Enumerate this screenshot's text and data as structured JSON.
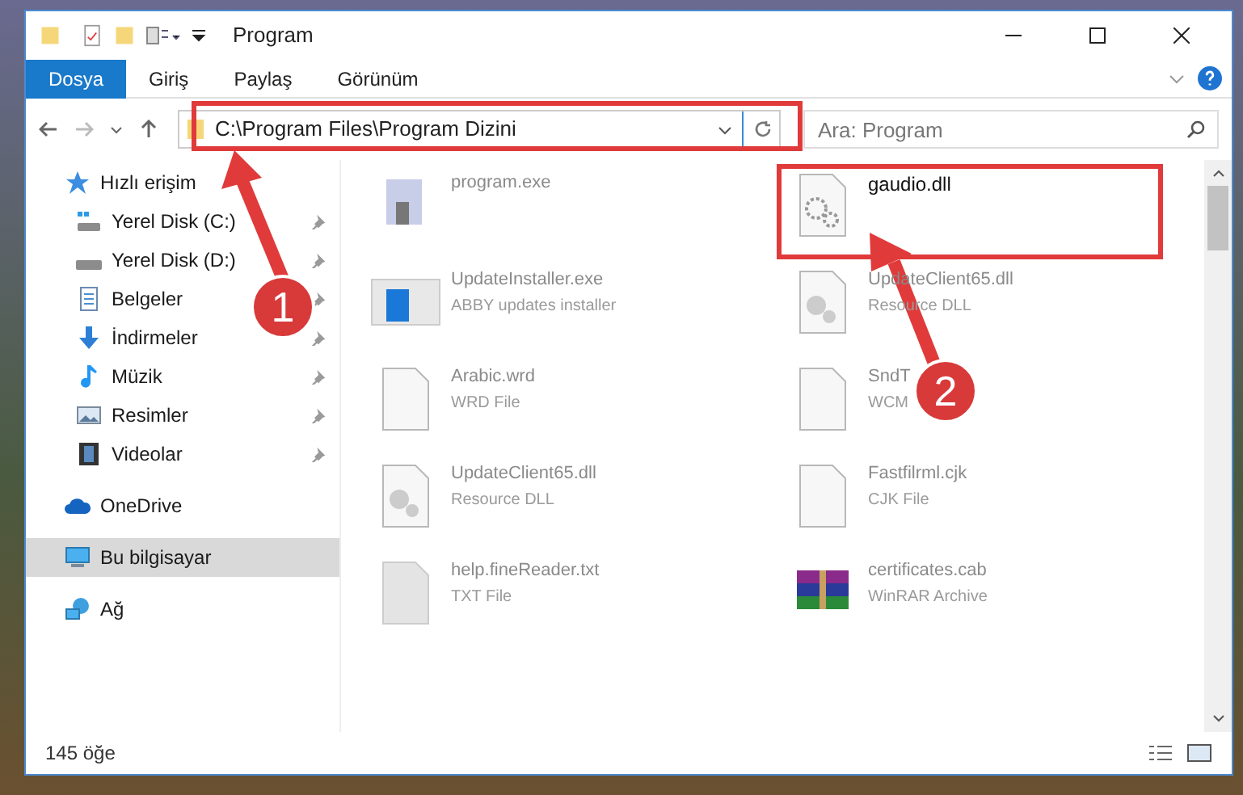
{
  "window": {
    "title": "Program"
  },
  "ribbon_tabs": [
    {
      "label": "Dosya",
      "selected": true
    },
    {
      "label": "Giriş",
      "selected": false
    },
    {
      "label": "Paylaş",
      "selected": false
    },
    {
      "label": "Görünüm",
      "selected": false
    }
  ],
  "address_bar": {
    "value": "C:\\Program Files\\Program Dizini"
  },
  "search": {
    "placeholder": "Ara: Program"
  },
  "sidebar": {
    "items": [
      {
        "label": "Hızlı erişim",
        "kind": "star",
        "selected": false,
        "children": [
          {
            "label": "Yerel Disk (C:)",
            "kind": "drive-windows",
            "pinned": true,
            "selected": false
          },
          {
            "label": "Yerel Disk (D:)",
            "kind": "drive",
            "pinned": true,
            "selected": false
          },
          {
            "label": "Belgeler",
            "kind": "documents",
            "pinned": true,
            "selected": false
          },
          {
            "label": "İndirmeler",
            "kind": "download",
            "pinned": true,
            "selected": false
          },
          {
            "label": "Müzik",
            "kind": "music",
            "pinned": true,
            "selected": false
          },
          {
            "label": "Resimler",
            "kind": "pictures",
            "pinned": true,
            "selected": false
          },
          {
            "label": "Videolar",
            "kind": "videos",
            "pinned": true,
            "selected": false
          }
        ]
      },
      {
        "label": "OneDrive",
        "kind": "cloud",
        "selected": false
      },
      {
        "label": "Bu bilgisayar",
        "kind": "computer",
        "selected": true
      },
      {
        "label": "Ağ",
        "kind": "network",
        "selected": false
      }
    ]
  },
  "files": [
    {
      "name": "program.exe",
      "kind": "app",
      "faded": true
    },
    {
      "name": "gaudio.dll",
      "kind": "gear",
      "faded": false
    },
    {
      "name": "UpdateInstaller.exe",
      "type": "ABBY updates installer",
      "kind": "installer",
      "faded": true
    },
    {
      "name": "UpdateClient65.dll",
      "type": "Resource DLL",
      "kind": "dll",
      "faded": true
    },
    {
      "name": "Arabic.wrd",
      "type": "WRD File",
      "kind": "blank",
      "faded": true
    },
    {
      "name": "SndT",
      "type": "WCM",
      "kind": "blank",
      "faded": true
    },
    {
      "name": "UpdateClient65.dll",
      "type": "Resource DLL",
      "kind": "dll",
      "faded": true
    },
    {
      "name": "Fastfilrml.cjk",
      "type": "CJK File",
      "kind": "blank",
      "faded": true
    },
    {
      "name": "help.fineReader.txt",
      "type": "TXT File",
      "kind": "text",
      "faded": true
    },
    {
      "name": "certificates.cab",
      "type": "WinRAR Archive",
      "kind": "archive",
      "faded": true
    }
  ],
  "status_bar": {
    "count": "145 öğe"
  },
  "annotations": [
    {
      "label": "1"
    },
    {
      "label": "2"
    }
  ]
}
